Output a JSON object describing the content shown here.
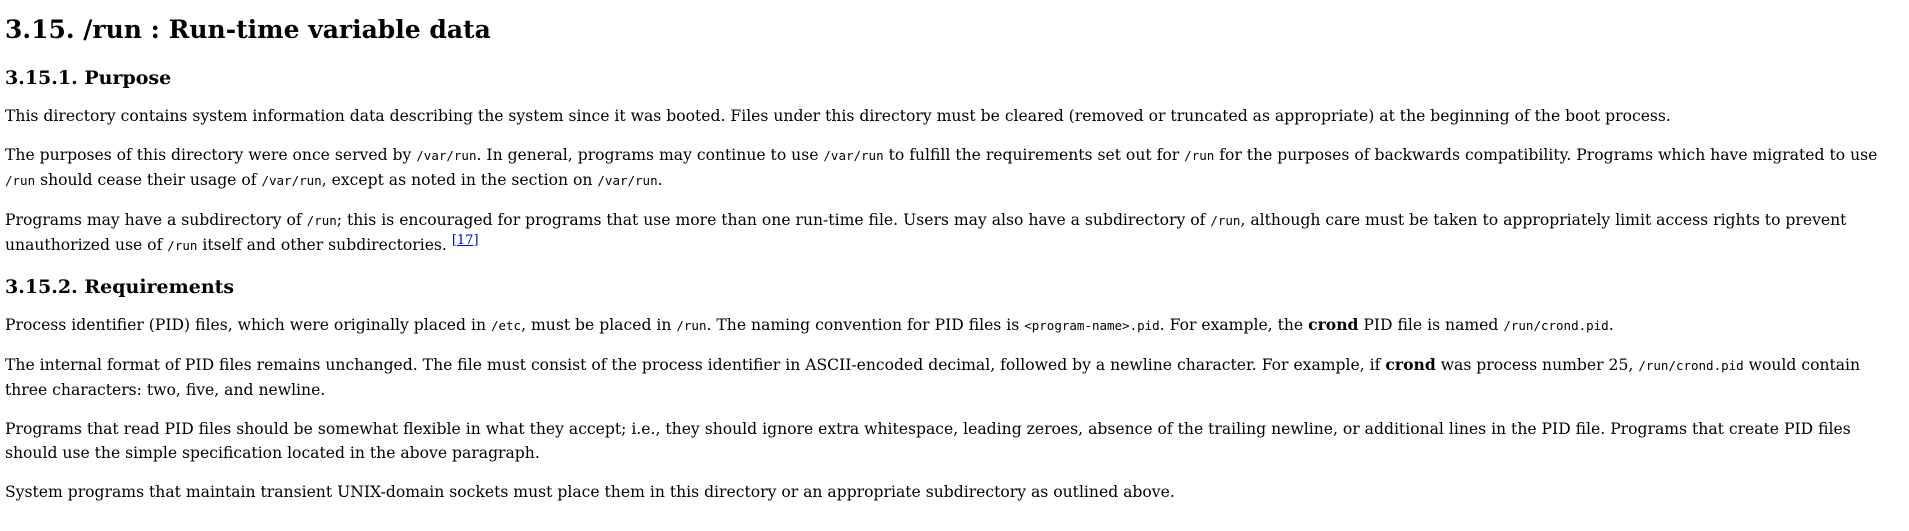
{
  "title": "3.15. /run : Run-time variable data",
  "purpose": {
    "heading": "3.15.1. Purpose",
    "p1": "This directory contains system information data describing the system since it was booted. Files under this directory must be cleared (removed or truncated as appropriate) at the beginning of the boot process.",
    "p2": {
      "t1": "The purposes of this directory were once served by ",
      "c1": "/var/run",
      "t2": ". In general, programs may continue to use ",
      "c2": "/var/run",
      "t3": " to fulfill the requirements set out for ",
      "c3": "/run",
      "t4": " for the purposes of backwards compatibility. Programs which have migrated to use ",
      "c4": "/run",
      "t5": " should cease their usage of ",
      "c5": "/var/run",
      "t6": ", except as noted in the section on ",
      "c6": "/var/run",
      "t7": "."
    },
    "p3": {
      "t1": "Programs may have a subdirectory of ",
      "c1": "/run",
      "t2": "; this is encouraged for programs that use more than one run-time file. Users may also have a subdirectory of ",
      "c2": "/run",
      "t3": ", although care must be taken to appropriately limit access rights to prevent unauthorized use of ",
      "c3": "/run",
      "t4": " itself and other subdirectories. ",
      "footnote": "[17]"
    }
  },
  "requirements": {
    "heading": "3.15.2. Requirements",
    "p1": {
      "t1": "Process identifier (PID) files, which were originally placed in ",
      "c1": "/etc",
      "t2": ", must be placed in ",
      "c2": "/run",
      "t3": ". The naming convention for PID files is ",
      "c3": "<program-name>.pid",
      "t4": ". For example, the ",
      "b1": "crond",
      "t5": " PID file is named ",
      "c4": "/run/crond.pid",
      "t6": "."
    },
    "p2": {
      "t1": "The internal format of PID files remains unchanged. The file must consist of the process identifier in ASCII-encoded decimal, followed by a newline character. For example, if ",
      "b1": "crond",
      "t2": " was process number 25, ",
      "c1": "/run/crond.pid",
      "t3": " would contain three characters: two, five, and newline."
    },
    "p3": "Programs that read PID files should be somewhat flexible in what they accept; i.e., they should ignore extra whitespace, leading zeroes, absence of the trailing newline, or additional lines in the PID file. Programs that create PID files should use the simple specification located in the above paragraph.",
    "p4": "System programs that maintain transient UNIX-domain sockets must place them in this directory or an appropriate subdirectory as outlined above."
  }
}
